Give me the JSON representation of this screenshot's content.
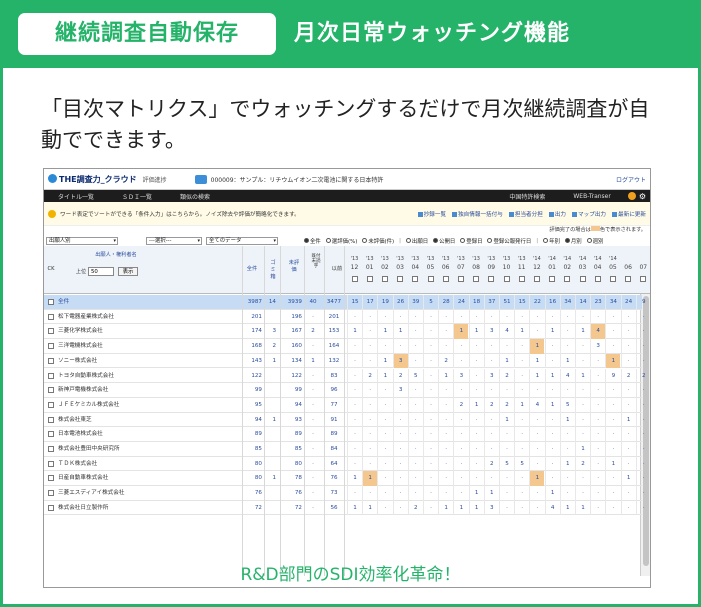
{
  "header": {
    "badge": "継続調査自動保存",
    "title": "月次日常ウォッチング機能"
  },
  "lead": "「目次マトリクス」でウォッチングするだけで月次継続調査が自動でできます。",
  "caption": "R&D部門のSDI効率化革命！",
  "app": {
    "logo": "THE調査力_クラウド",
    "sub": "評価進捗",
    "project": "000009：サンプル：リチウムイオン二次電池に関する日本特許",
    "logout": "ログアウト",
    "nav": [
      "タイトル一覧",
      "ＳＤＩ一覧",
      "類似の検索"
    ],
    "nav_right": [
      "中国特許検索",
      "WEB-Transer"
    ],
    "notice": "ワード表定でソートができる「条件入力」はこちらから。ノイズ除去や評価が簡略化できます。",
    "tools": [
      "抄録一覧",
      "独自情報一括付与",
      "担当者分担",
      "出力",
      "マップ出力",
      "最新に更新"
    ],
    "note": "評価完了の場合は",
    "note_suffix": "色で表示されます。",
    "filters": {
      "select1": "出願人別",
      "select2": "---選択---",
      "select3": "全てのデータ"
    },
    "radios": [
      "全件",
      "選評価(%)",
      "未評価(件)",
      "出願日",
      "公開日",
      "登録日",
      "登録公報発行日",
      "年別",
      "月別",
      "週別"
    ],
    "table": {
      "ck": "CK",
      "applicant_header": "出願人・権利者名",
      "limit_label": "上位",
      "limit_value": "50",
      "show_button": "表示",
      "col_total": "全件",
      "col_noise": "ゴミ箱",
      "col_unrated": "未評価",
      "col_unread": "既付未読字",
      "col_misc": "以前",
      "years": [
        "'13",
        "'13",
        "'13",
        "'13",
        "'13",
        "'13",
        "'13",
        "'13",
        "'13",
        "'13",
        "'13",
        "'13",
        "'14",
        "'14",
        "'14",
        "'14",
        "'14",
        "'14"
      ],
      "months": [
        "12",
        "01",
        "02",
        "03",
        "04",
        "05",
        "06",
        "07",
        "08",
        "09",
        "10",
        "11",
        "12",
        "01",
        "02",
        "03",
        "04",
        "05",
        "06",
        "07"
      ],
      "rows": [
        {
          "name": "全件",
          "total": "3987",
          "noise": "14",
          "unrated": "3939",
          "unread": "40",
          "before": "3477",
          "cells": [
            "15",
            "17",
            "19",
            "26",
            "39",
            "5",
            "28",
            "24",
            "18",
            "37",
            "51",
            "15",
            "22",
            "16",
            "34",
            "14",
            "23",
            "34",
            "24",
            "9"
          ]
        },
        {
          "name": "松下電器産業株式会社",
          "total": "201",
          "noise": "",
          "unrated": "196",
          "unread": "·",
          "before": "201",
          "cells": [
            "·",
            "·",
            "·",
            "·",
            "·",
            "·",
            "·",
            "·",
            "·",
            "·",
            "·",
            "·",
            "·",
            "·",
            "·",
            "·",
            "·",
            "·",
            "·",
            "·"
          ]
        },
        {
          "name": "三菱化学株式会社",
          "total": "174",
          "noise": "3",
          "unrated": "167",
          "unread": "2",
          "before": "153",
          "cells": [
            "1",
            "·",
            "1",
            "1",
            "·",
            "·",
            "·",
            "1",
            "1",
            "3",
            "4",
            "1",
            "·",
            "1",
            "·",
            "1",
            "4",
            "·",
            "·",
            "·"
          ]
        },
        {
          "name": "三洋電機株式会社",
          "total": "168",
          "noise": "2",
          "unrated": "160",
          "unread": "·",
          "before": "164",
          "cells": [
            "·",
            "·",
            "·",
            "·",
            "·",
            "·",
            "·",
            "·",
            "·",
            "·",
            "·",
            "·",
            "1",
            "·",
            "·",
            "·",
            "3",
            "·",
            "·",
            "·"
          ]
        },
        {
          "name": "ソニー株式会社",
          "total": "143",
          "noise": "1",
          "unrated": "134",
          "unread": "1",
          "before": "132",
          "cells": [
            "·",
            "·",
            "1",
            "3",
            "·",
            "·",
            "2",
            "·",
            "·",
            "·",
            "1",
            "·",
            "1",
            "·",
            "1",
            "·",
            "·",
            "1",
            "·",
            "·"
          ]
        },
        {
          "name": "トヨタ自動車株式会社",
          "total": "122",
          "noise": "",
          "unrated": "122",
          "unread": "·",
          "before": "83",
          "cells": [
            "·",
            "2",
            "1",
            "2",
            "5",
            "·",
            "1",
            "3",
            "·",
            "3",
            "2",
            "·",
            "1",
            "1",
            "4",
            "1",
            "·",
            "9",
            "2",
            "2"
          ]
        },
        {
          "name": "新神戸電機株式会社",
          "total": "99",
          "noise": "",
          "unrated": "99",
          "unread": "·",
          "before": "96",
          "cells": [
            "·",
            "·",
            "·",
            "3",
            "·",
            "·",
            "·",
            "·",
            "·",
            "·",
            "·",
            "·",
            "·",
            "·",
            "·",
            "·",
            "·",
            "·",
            "·",
            "·"
          ]
        },
        {
          "name": "ＪＦＥケミカル株式会社",
          "total": "95",
          "noise": "",
          "unrated": "94",
          "unread": "·",
          "before": "77",
          "cells": [
            "·",
            "·",
            "·",
            "·",
            "·",
            "·",
            "·",
            "2",
            "1",
            "2",
            "2",
            "1",
            "4",
            "1",
            "5",
            "·",
            "·",
            "·",
            "·",
            "·"
          ]
        },
        {
          "name": "株式会社東芝",
          "total": "94",
          "noise": "1",
          "unrated": "93",
          "unread": "·",
          "before": "91",
          "cells": [
            "·",
            "·",
            "·",
            "·",
            "·",
            "·",
            "·",
            "·",
            "·",
            "·",
            "1",
            "·",
            "·",
            "·",
            "1",
            "·",
            "·",
            "·",
            "1",
            "·"
          ]
        },
        {
          "name": "日本電池株式会社",
          "total": "89",
          "noise": "",
          "unrated": "89",
          "unread": "·",
          "before": "89",
          "cells": [
            "·",
            "·",
            "·",
            "·",
            "·",
            "·",
            "·",
            "·",
            "·",
            "·",
            "·",
            "·",
            "·",
            "·",
            "·",
            "·",
            "·",
            "·",
            "·",
            "·"
          ]
        },
        {
          "name": "株式会社豊田中央研究所",
          "total": "85",
          "noise": "",
          "unrated": "85",
          "unread": "·",
          "before": "84",
          "cells": [
            "·",
            "·",
            "·",
            "·",
            "·",
            "·",
            "·",
            "·",
            "·",
            "·",
            "·",
            "·",
            "·",
            "·",
            "·",
            "1",
            "·",
            "·",
            "·",
            "·"
          ]
        },
        {
          "name": "ＴＤＫ株式会社",
          "total": "80",
          "noise": "",
          "unrated": "80",
          "unread": "·",
          "before": "64",
          "cells": [
            "·",
            "·",
            "·",
            "·",
            "·",
            "·",
            "·",
            "·",
            "·",
            "2",
            "5",
            "5",
            "·",
            "·",
            "1",
            "2",
            "·",
            "1",
            "·",
            "·"
          ]
        },
        {
          "name": "日産自動車株式会社",
          "total": "80",
          "noise": "1",
          "unrated": "78",
          "unread": "·",
          "before": "76",
          "cells": [
            "1",
            "1",
            "·",
            "·",
            "·",
            "·",
            "·",
            "·",
            "·",
            "·",
            "·",
            "·",
            "1",
            "·",
            "·",
            "·",
            "·",
            "·",
            "1",
            "·"
          ]
        },
        {
          "name": "三菱エスディアイ株式会社",
          "total": "76",
          "noise": "",
          "unrated": "76",
          "unread": "·",
          "before": "73",
          "cells": [
            "·",
            "·",
            "·",
            "·",
            "·",
            "·",
            "·",
            "·",
            "1",
            "1",
            "·",
            "·",
            "·",
            "1",
            "·",
            "·",
            "·",
            "·",
            "·",
            "·"
          ]
        },
        {
          "name": "株式会社日立製作所",
          "total": "72",
          "noise": "",
          "unrated": "72",
          "unread": "·",
          "before": "56",
          "cells": [
            "1",
            "1",
            "·",
            "·",
            "2",
            "·",
            "1",
            "1",
            "1",
            "3",
            "·",
            "·",
            "·",
            "4",
            "1",
            "1",
            "·",
            "·",
            "·",
            "·"
          ]
        }
      ]
    }
  }
}
